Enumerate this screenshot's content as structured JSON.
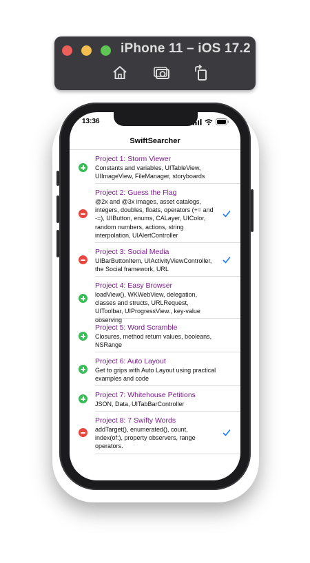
{
  "simulator": {
    "title": "iPhone 11 – iOS 17.2",
    "tools": [
      "home-icon",
      "screenshot-icon",
      "rotate-icon"
    ]
  },
  "status_bar": {
    "time": "13:36"
  },
  "nav": {
    "title": "SwiftSearcher"
  },
  "colors": {
    "title": "#7a1a8b",
    "add": "#37bc56",
    "delete": "#e8463e",
    "check": "#1d7af2"
  },
  "projects": [
    {
      "title": "Project 1: Storm Viewer",
      "subtitle": "Constants and variables, UITableView, UIImageView, FileManager, storyboards",
      "state": "add",
      "checked": false
    },
    {
      "title": "Project 2: Guess the Flag",
      "subtitle": "@2x and @3x images, asset catalogs, integers, doubles, floats, operators (+= and -=), UIButton, enums, CALayer, UIColor, random numbers, actions, string interpolation, UIAlertController",
      "state": "delete",
      "checked": true
    },
    {
      "title": "Project 3: Social Media",
      "subtitle": "UIBarButtonItem, UIActivityViewController, the Social framework, URL",
      "state": "delete",
      "checked": true
    },
    {
      "title": "Project 4: Easy Browser",
      "subtitle": "loadView(), WKWebView, delegation, classes and structs, URLRequest, UIToolbar, UIProgressView., key-value observing",
      "state": "add",
      "checked": false
    },
    {
      "title": "Project 5: Word Scramble",
      "subtitle": "Closures, method return values, booleans, NSRange",
      "state": "add",
      "checked": false
    },
    {
      "title": "Project 6: Auto Layout",
      "subtitle": "Get to grips with Auto Layout using practical examples and code",
      "state": "add",
      "checked": false
    },
    {
      "title": "Project 7: Whitehouse Petitions",
      "subtitle": "JSON, Data, UITabBarController",
      "state": "add",
      "checked": false
    },
    {
      "title": "Project 8: 7 Swifty Words",
      "subtitle": "addTarget(), enumerated(), count, index(of:), property observers, range operators.",
      "state": "delete",
      "checked": true
    }
  ]
}
